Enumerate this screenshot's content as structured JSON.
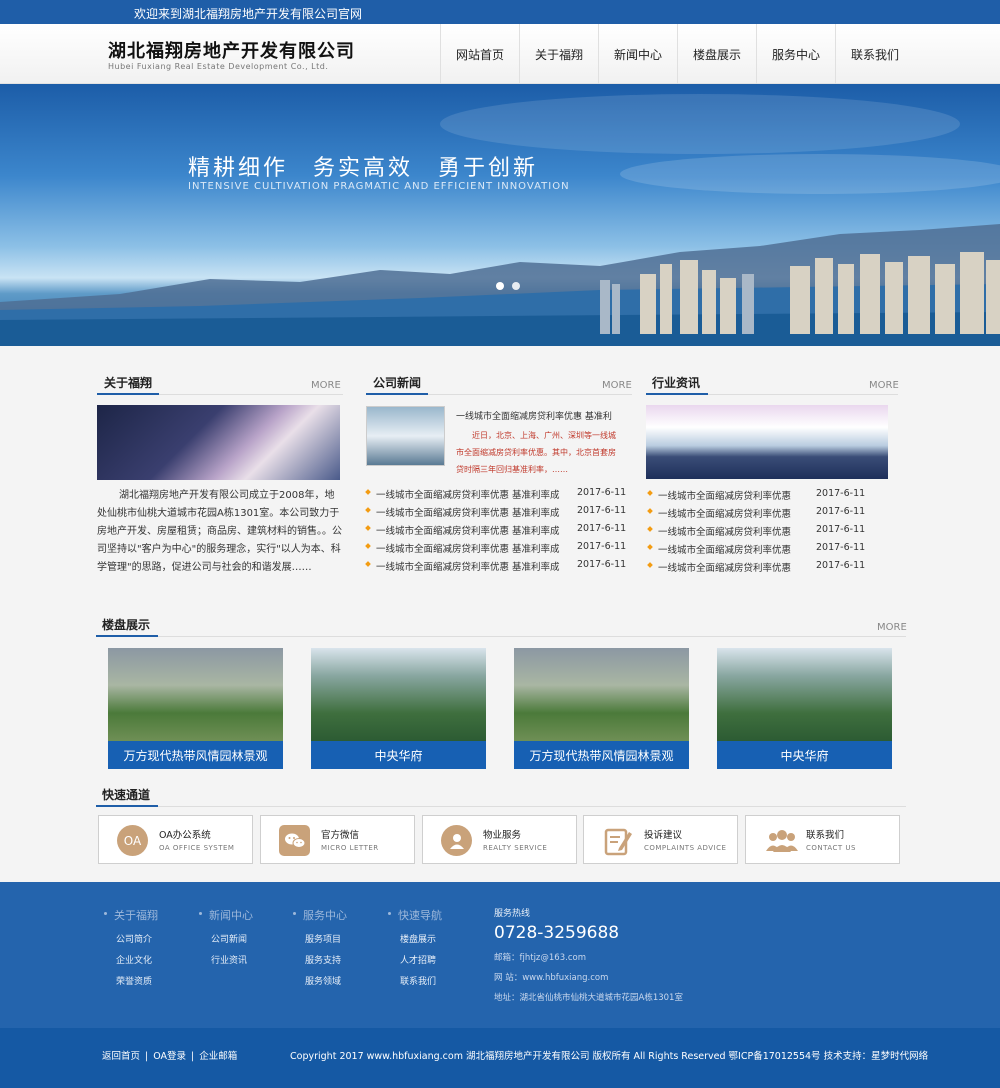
{
  "topbar": {
    "welcome": "欢迎来到湖北福翔房地产开发有限公司官网"
  },
  "header": {
    "company_cn": "湖北福翔房地产开发有限公司",
    "company_en": "Hubei Fuxiang Real Estate Development Co., Ltd.",
    "nav": [
      "网站首页",
      "关于福翔",
      "新闻中心",
      "楼盘展示",
      "服务中心",
      "联系我们"
    ]
  },
  "banner": {
    "slogan_cn": "精耕细作　务实高效　勇于创新",
    "slogan_en": "INTENSIVE CULTIVATION PRAGMATIC AND EFFICIENT INNOVATION",
    "slide_count": 2
  },
  "about": {
    "title": "关于福翔",
    "more": "MORE",
    "text": "湖北福翔房地产开发有限公司成立于2008年，地处仙桃市仙桃大道城市花园A栋1301室。本公司致力于房地产开发、房屋租赁；商品房、建筑材料的销售。。公司坚持以\"客户为中心\"的服务理念，实行\"以人为本、科学管理\"的思路，促进公司与社会的和谐发展……"
  },
  "news": {
    "title": "公司新闻",
    "more": "MORE",
    "headline": "一线城市全面缩减房贷利率优惠 基准利",
    "summary": "近日，北京、上海、广州、深圳等一线城市全面缩减房贷利率优惠。其中，北京首套房贷时隔三年回归基准利率，……",
    "items": [
      {
        "title": "一线城市全面缩减房贷利率优惠 基准利率成",
        "date": "2017-6-11"
      },
      {
        "title": "一线城市全面缩减房贷利率优惠 基准利率成",
        "date": "2017-6-11"
      },
      {
        "title": "一线城市全面缩减房贷利率优惠 基准利率成",
        "date": "2017-6-11"
      },
      {
        "title": "一线城市全面缩减房贷利率优惠 基准利率成",
        "date": "2017-6-11"
      },
      {
        "title": "一线城市全面缩减房贷利率优惠 基准利率成",
        "date": "2017-6-11"
      }
    ]
  },
  "industry": {
    "title": "行业资讯",
    "more": "MORE",
    "items": [
      {
        "title": "一线城市全面缩减房贷利率优惠",
        "date": "2017-6-11"
      },
      {
        "title": "一线城市全面缩减房贷利率优惠",
        "date": "2017-6-11"
      },
      {
        "title": "一线城市全面缩减房贷利率优惠",
        "date": "2017-6-11"
      },
      {
        "title": "一线城市全面缩减房贷利率优惠",
        "date": "2017-6-11"
      },
      {
        "title": "一线城市全面缩减房贷利率优惠",
        "date": "2017-6-11"
      }
    ]
  },
  "properties": {
    "title": "楼盘展示",
    "more": "MORE",
    "items": [
      {
        "name": "万方现代热带风情园林景观"
      },
      {
        "name": "中央华府"
      },
      {
        "name": "万方现代热带风情园林景观"
      },
      {
        "name": "中央华府"
      }
    ]
  },
  "quick": {
    "title": "快速通道",
    "items": [
      {
        "name": "OA办公系统",
        "en": "OA OFFICE SYSTEM",
        "icon": "oa-icon",
        "icon_text": "OA"
      },
      {
        "name": "官方微信",
        "en": "MICRO LETTER",
        "icon": "wechat-icon"
      },
      {
        "name": "物业服务",
        "en": "REALTY SERVICE",
        "icon": "user-icon"
      },
      {
        "name": "投诉建议",
        "en": "COMPLAINTS  ADVICE",
        "icon": "edit-icon"
      },
      {
        "name": "联系我们",
        "en": "CONTACT US",
        "icon": "group-icon"
      }
    ]
  },
  "footer": {
    "cols": [
      {
        "title": "关于福翔",
        "items": [
          "公司简介",
          "企业文化",
          "荣誉资质"
        ]
      },
      {
        "title": "新闻中心",
        "items": [
          "公司新闻",
          "行业资讯"
        ]
      },
      {
        "title": "服务中心",
        "items": [
          "服务项目",
          "服务支持",
          "服务领域"
        ]
      },
      {
        "title": "快速导航",
        "items": [
          "楼盘展示",
          "人才招聘",
          "联系我们"
        ]
      }
    ],
    "hotline_label": "服务热线",
    "phone": "0728-3259688",
    "email": "邮箱：fjhtjz@163.com",
    "site": "网 站：www.hbfuxiang.com",
    "address": "地址：湖北省仙桃市仙桃大道城市花园A栋1301室"
  },
  "bottom": {
    "links": [
      "返回首页",
      "OA登录",
      "企业邮箱"
    ],
    "copyright": "Copyright 2017 www.hbfuxiang.com 湖北福翔房地产开发有限公司 版权所有 All Rights Reserved 鄂ICP备17012554号 技术支持：星梦时代网络"
  },
  "colors": {
    "primary": "#1f5ea8",
    "caption": "#1760b3",
    "footer": "#2464ad",
    "bullet": "#f39c12",
    "icon": "#c9a27a"
  }
}
